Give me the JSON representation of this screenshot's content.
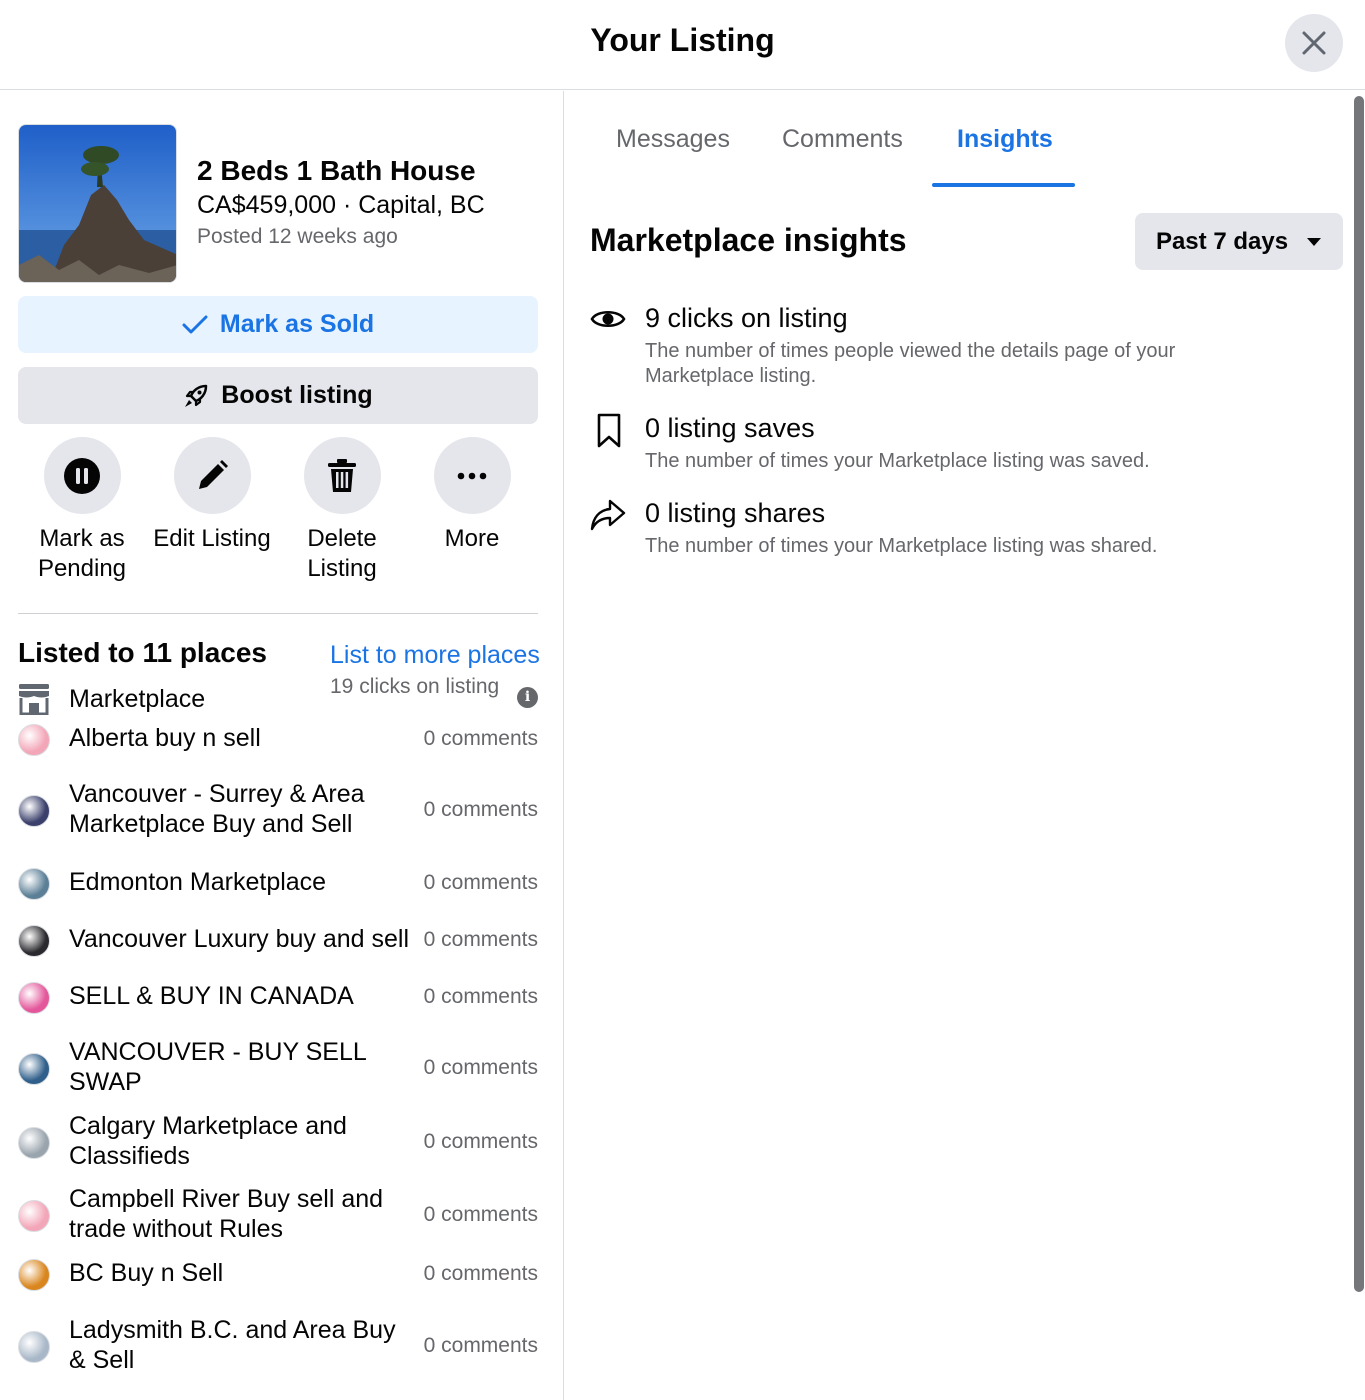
{
  "header": {
    "title": "Your Listing"
  },
  "listing": {
    "title": "2 Beds 1 Bath House",
    "price_location": "CA$459,000 · Capital, BC",
    "posted": "Posted 12 weeks ago"
  },
  "buttons": {
    "mark_sold": "Mark as Sold",
    "boost": "Boost listing"
  },
  "actions": {
    "pending": "Mark as Pending",
    "edit": "Edit Listing",
    "delete": "Delete Listing",
    "more": "More"
  },
  "places": {
    "title": "Listed to 11 places",
    "list_more": "List to more places",
    "marketplace": {
      "name": "Marketplace",
      "clicks": "19 clicks on listing"
    },
    "groups": [
      {
        "name": "Alberta buy n sell",
        "count": "0 comments",
        "color": "#f3a6b8"
      },
      {
        "name": "Vancouver - Surrey & Area Marketplace Buy and Sell",
        "count": "0 comments",
        "color": "#3a3f6b"
      },
      {
        "name": "Edmonton Marketplace",
        "count": "0 comments",
        "color": "#5b7f96"
      },
      {
        "name": "Vancouver Luxury buy and sell",
        "count": "0 comments",
        "color": "#2a2a2e"
      },
      {
        "name": "SELL & BUY IN CANADA",
        "count": "0 comments",
        "color": "#e4579b"
      },
      {
        "name": "VANCOUVER - BUY SELL SWAP",
        "count": "0 comments",
        "color": "#2f5f8a"
      },
      {
        "name": "Calgary Marketplace and Classifieds",
        "count": "0 comments",
        "color": "#9aa4ad"
      },
      {
        "name": "Campbell River Buy sell and trade without Rules",
        "count": "0 comments",
        "color": "#f3a6b8"
      },
      {
        "name": "BC Buy n Sell",
        "count": "0 comments",
        "color": "#d9861e"
      },
      {
        "name": "Ladysmith B.C. and Area Buy & Sell",
        "count": "0 comments",
        "color": "#a9b8c8"
      }
    ]
  },
  "tabs": {
    "messages": "Messages",
    "comments": "Comments",
    "insights": "Insights"
  },
  "insights": {
    "heading": "Marketplace insights",
    "range": "Past 7 days",
    "stats": [
      {
        "title": "9 clicks on listing",
        "desc": "The number of times people viewed the details page of your Marketplace listing."
      },
      {
        "title": "0 listing saves",
        "desc": "The number of times your Marketplace listing was saved."
      },
      {
        "title": "0 listing shares",
        "desc": "The number of times your Marketplace listing was shared."
      }
    ]
  },
  "colors": {
    "accent": "#1b74e4",
    "secondary_text": "#65676b",
    "button_gray": "#e4e6eb",
    "light_blue": "#e7f3ff"
  }
}
